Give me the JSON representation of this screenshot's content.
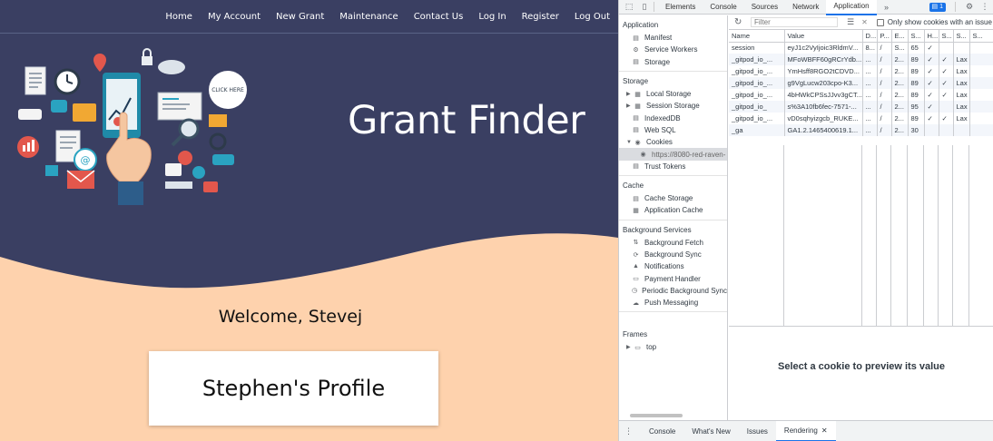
{
  "site": {
    "nav": [
      "Home",
      "My Account",
      "New Grant",
      "Maintenance",
      "Contact Us",
      "Log In",
      "Register",
      "Log Out"
    ],
    "title": "Grant Finder",
    "illustration_badge": "CLICK HERE",
    "welcome": "Welcome, Stevej",
    "profile_card": "Stephen's Profile",
    "colors": {
      "navy": "#3a3f62",
      "peach": "#fed2ad"
    }
  },
  "devtools": {
    "tabs": [
      "Elements",
      "Console",
      "Sources",
      "Network",
      "Application"
    ],
    "active_tab": "Application",
    "issues_count": "1",
    "sidebar": {
      "application_title": "Application",
      "application_items": [
        "Manifest",
        "Service Workers",
        "Storage"
      ],
      "storage_title": "Storage",
      "storage_items": [
        "Local Storage",
        "Session Storage",
        "IndexedDB",
        "Web SQL",
        "Cookies"
      ],
      "cookie_origin": "https://8080-red-raven-",
      "trust_tokens": "Trust Tokens",
      "cache_title": "Cache",
      "cache_items": [
        "Cache Storage",
        "Application Cache"
      ],
      "bg_title": "Background Services",
      "bg_items": [
        "Background Fetch",
        "Background Sync",
        "Notifications",
        "Payment Handler",
        "Periodic Background Sync",
        "Push Messaging"
      ],
      "frames_title": "Frames",
      "frames_items": [
        "top"
      ]
    },
    "filter": {
      "placeholder": "Filter",
      "only_issues_label": "Only show cookies with an issue"
    },
    "columns": [
      "Name",
      "Value",
      "D...",
      "P...",
      "E...",
      "S...",
      "H...",
      "S...",
      "S...",
      "S..."
    ],
    "rows": [
      [
        "session",
        "eyJ1c2VyIjoic3RldmV...",
        "8...",
        "/",
        "S...",
        "65",
        "✓",
        "",
        "",
        ""
      ],
      [
        "_gitpod_io_...",
        "MFoWBFF60gRCrYdb...",
        "...",
        "/",
        "2...",
        "89",
        "✓",
        "✓",
        "Lax",
        ""
      ],
      [
        "_gitpod_io_...",
        "YmHsff8RGO2tCDVD...",
        "...",
        "/",
        "2...",
        "89",
        "✓",
        "✓",
        "Lax",
        ""
      ],
      [
        "_gitpod_io_...",
        "g9VgLucw203cpo-K3...",
        "...",
        "/",
        "2...",
        "89",
        "✓",
        "✓",
        "Lax",
        ""
      ],
      [
        "_gitpod_io_...",
        "4bHWkCPSsJJvv3gCT...",
        "...",
        "/",
        "2...",
        "89",
        "✓",
        "✓",
        "Lax",
        ""
      ],
      [
        "_gitpod_io_",
        "s%3A10fb6fec-7571-...",
        "...",
        "/",
        "2...",
        "95",
        "✓",
        "",
        "Lax",
        ""
      ],
      [
        "_gitpod_io_...",
        "vD0sqhyizgcb_RUKE...",
        "...",
        "/",
        "2...",
        "89",
        "✓",
        "✓",
        "Lax",
        ""
      ],
      [
        "_ga",
        "GA1.2.1465400619.1...",
        "...",
        "/",
        "2...",
        "30",
        "",
        "",
        "",
        ""
      ]
    ],
    "preview_text": "Select a cookie to preview its value",
    "drawer_tabs": [
      "Console",
      "What's New",
      "Issues",
      "Rendering"
    ],
    "drawer_active": "Rendering"
  }
}
